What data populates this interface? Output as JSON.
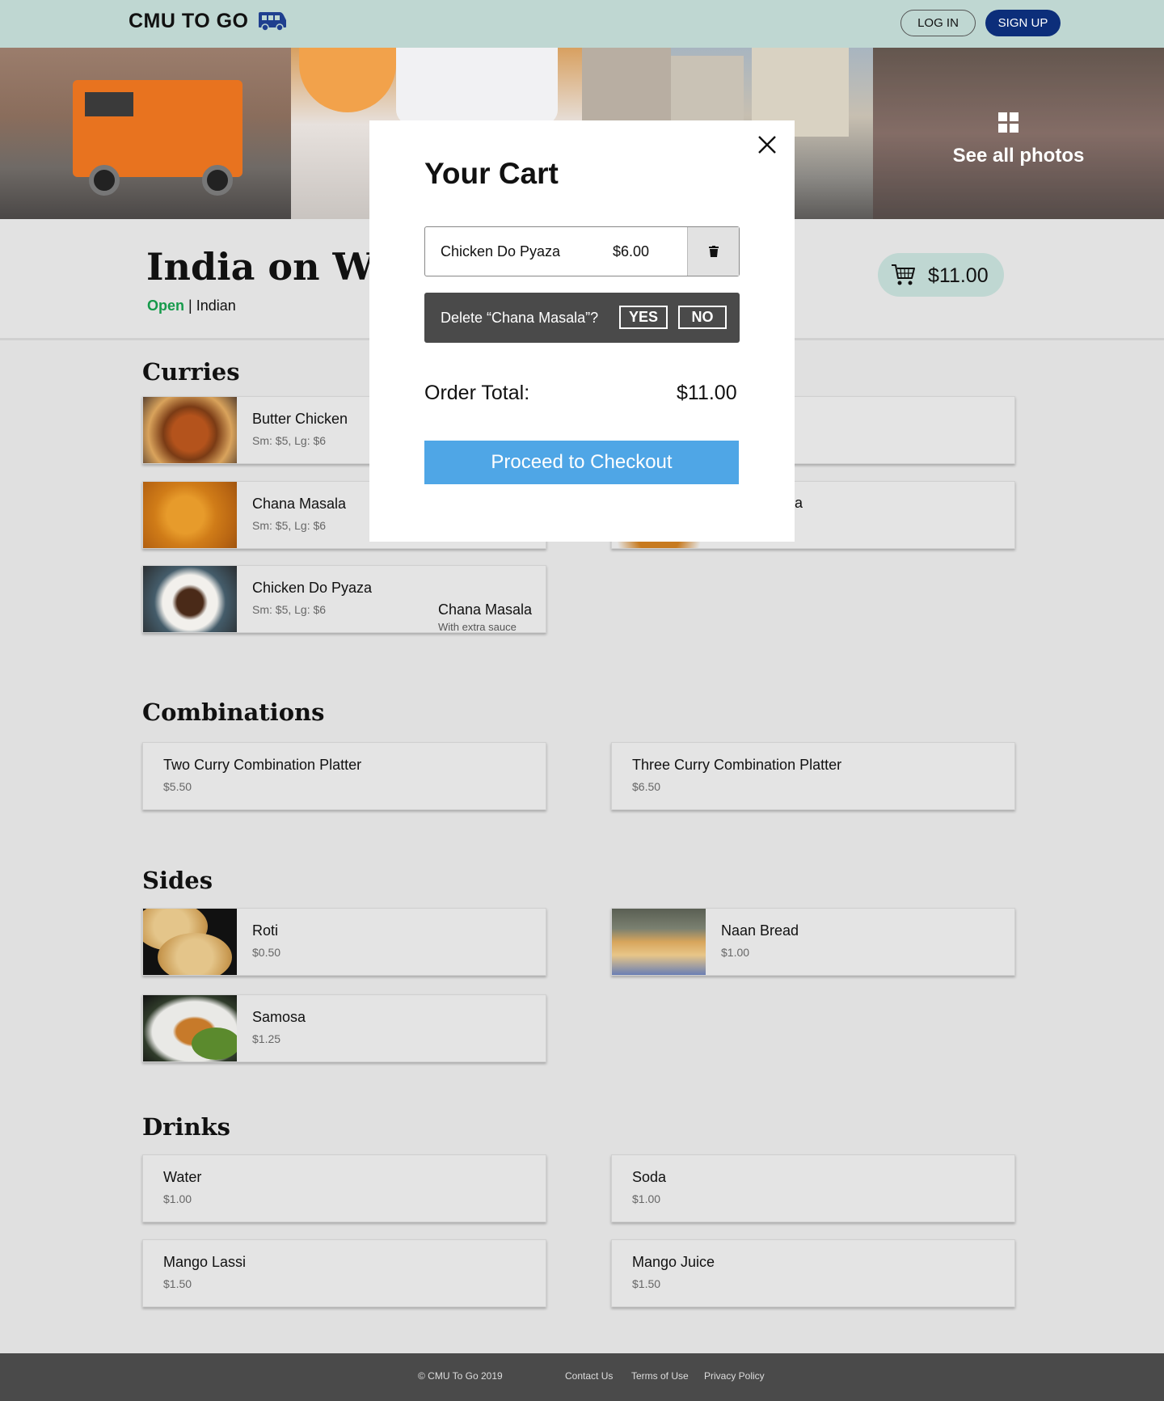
{
  "header": {
    "logo": "CMU TO GO",
    "login_label": "LOG IN",
    "signup_label": "SIGN UP"
  },
  "photos": {
    "see_all_label": "See all photos"
  },
  "restaurant": {
    "name": "India on Whe",
    "status": "Open",
    "separator": " | ",
    "cuisine": "Indian",
    "cart_total": "$11.00"
  },
  "menu": {
    "curries": {
      "title": "Curries",
      "items": [
        {
          "name": "Butter Chicken",
          "price": "Sm: $5, Lg: $6"
        },
        {
          "name": "Chana Masala",
          "price": "Sm: $5, Lg: $6"
        },
        {
          "name": "Chicken Do Pyaza",
          "price": "Sm: $5, Lg: $6"
        }
      ],
      "partial_right_label": "ma"
    },
    "combinations": {
      "title": "Combinations",
      "items": [
        {
          "name": "Two Curry Combination Platter",
          "price": "$5.50"
        },
        {
          "name": "Three Curry Combination Platter",
          "price": "$6.50"
        }
      ]
    },
    "sides": {
      "title": "Sides",
      "items": [
        {
          "name": "Roti",
          "price": "$0.50"
        },
        {
          "name": "Naan Bread",
          "price": "$1.00"
        },
        {
          "name": "Samosa",
          "price": "$1.25"
        }
      ]
    },
    "drinks": {
      "title": "Drinks",
      "items": [
        {
          "name": "Water",
          "price": "$1.00"
        },
        {
          "name": "Soda",
          "price": "$1.00"
        },
        {
          "name": "Mango Lassi",
          "price": "$1.50"
        },
        {
          "name": "Mango Juice",
          "price": "$1.50"
        }
      ]
    }
  },
  "dragging_item": {
    "name": "Chana Masala",
    "note": "With extra sauce"
  },
  "cart_modal": {
    "title": "Your Cart",
    "item_name": "Chicken Do Pyaza",
    "item_price": "$6.00",
    "confirm_text": "Delete “Chana Masala”?",
    "yes_label": "YES",
    "no_label": "NO",
    "total_label": "Order Total:",
    "total_value": "$11.00",
    "checkout_label": "Proceed to Checkout"
  },
  "footer": {
    "copyright": "© CMU To Go 2019",
    "contact": "Contact Us",
    "terms": "Terms of Use",
    "privacy": "Privacy Policy"
  },
  "colors": {
    "header_bg": "#bfd7d2",
    "signup_bg": "#0c2e7a",
    "open_green": "#169a4b",
    "checkout_blue": "#4fa6e6"
  }
}
